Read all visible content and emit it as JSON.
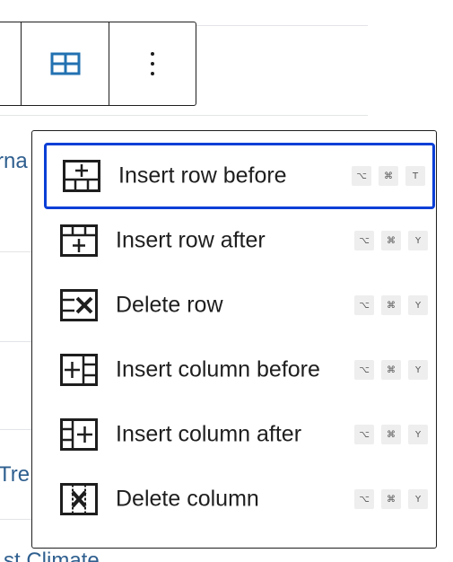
{
  "background": {
    "row_text_1": "rna",
    "row_text_2": "Tre",
    "row_text_3": "st Climate"
  },
  "toolbar": {
    "table_icon": "table-icon",
    "more_icon": "more-vertical-icon"
  },
  "menu": {
    "items": [
      {
        "label": "Insert row before",
        "icon": "table-row-before-icon",
        "focused": true,
        "shortcut": [
          "⌥",
          "⌘",
          "T"
        ]
      },
      {
        "label": "Insert row after",
        "icon": "table-row-after-icon",
        "focused": false,
        "shortcut": [
          "⌥",
          "⌘",
          "Y"
        ]
      },
      {
        "label": "Delete row",
        "icon": "table-row-delete-icon",
        "focused": false,
        "shortcut": [
          "⌥",
          "⌘",
          "Y"
        ]
      },
      {
        "label": "Insert column before",
        "icon": "table-column-before-icon",
        "focused": false,
        "shortcut": [
          "⌥",
          "⌘",
          "Y"
        ]
      },
      {
        "label": "Insert column after",
        "icon": "table-column-after-icon",
        "focused": false,
        "shortcut": [
          "⌥",
          "⌘",
          "Y"
        ]
      },
      {
        "label": "Delete column",
        "icon": "table-column-delete-icon",
        "focused": false,
        "shortcut": [
          "⌥",
          "⌘",
          "Y"
        ]
      }
    ]
  },
  "colors": {
    "focus_ring": "#0a3fd6",
    "link_text": "#2f5f8f",
    "table_icon": "#2271b1"
  }
}
